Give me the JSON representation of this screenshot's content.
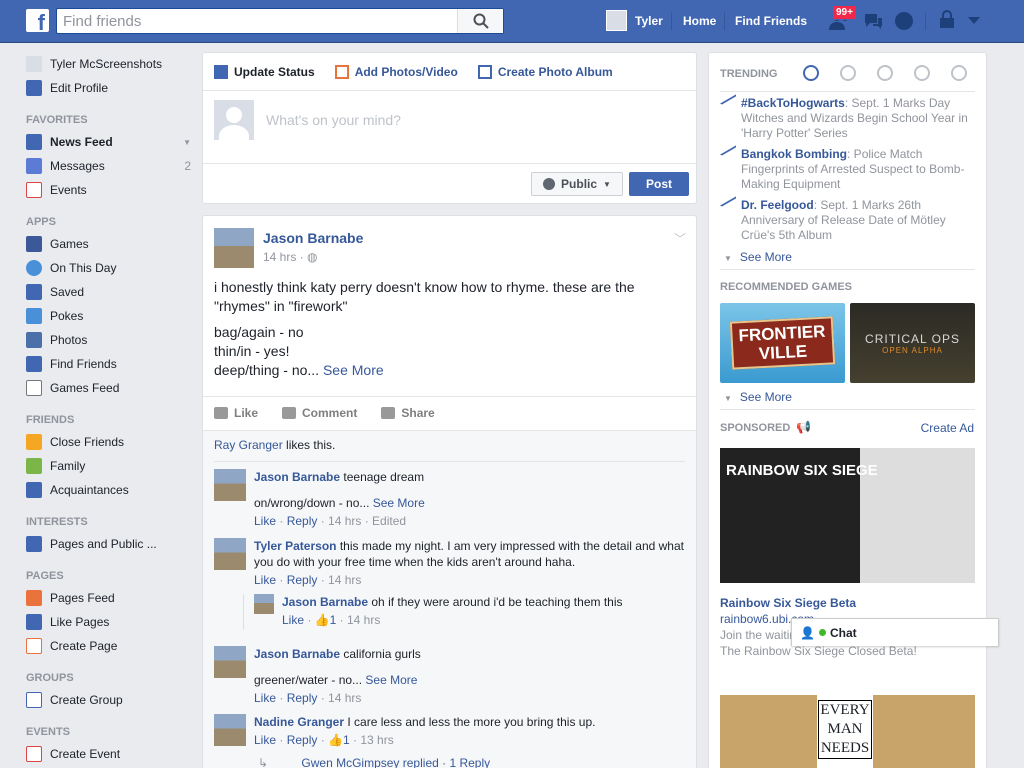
{
  "topbar": {
    "search_placeholder": "Find friends",
    "user_name": "Tyler",
    "home": "Home",
    "find_friends": "Find Friends",
    "friend_requests_badge": "99+"
  },
  "left_nav": {
    "user_name": "Tyler McScreenshots",
    "edit_profile": "Edit Profile",
    "favorites_header": "FAVORITES",
    "favorites": [
      {
        "label": "News Feed",
        "count": ""
      },
      {
        "label": "Messages",
        "count": "2"
      },
      {
        "label": "Events",
        "count": ""
      }
    ],
    "apps_header": "APPS",
    "apps": [
      "Games",
      "On This Day",
      "Saved",
      "Pokes",
      "Photos",
      "Find Friends",
      "Games Feed"
    ],
    "friends_header": "FRIENDS",
    "friends": [
      "Close Friends",
      "Family",
      "Acquaintances"
    ],
    "interests_header": "INTERESTS",
    "interests": [
      "Pages and Public ..."
    ],
    "pages_header": "PAGES",
    "pages": [
      "Pages Feed",
      "Like Pages",
      "Create Page"
    ],
    "groups_header": "GROUPS",
    "groups": [
      "Create Group"
    ],
    "events_header": "EVENTS",
    "events": [
      "Create Event"
    ]
  },
  "composer": {
    "tab_update_status": "Update Status",
    "tab_add_photos": "Add Photos/Video",
    "tab_create_album": "Create Photo Album",
    "placeholder": "What's on your mind?",
    "privacy": "Public",
    "post": "Post"
  },
  "post": {
    "author": "Jason Barnabe",
    "time": "14 hrs · ",
    "text_line1": "i honestly think katy perry doesn't know how to rhyme. these are the \"rhymes\" in \"firework\"",
    "text_line2": "bag/again - no",
    "text_line3": "thin/in - yes!",
    "text_line4": "deep/thing - no...",
    "see_more": "See More",
    "like": "Like",
    "comment": "Comment",
    "share": "Share",
    "likes_name": "Ray Granger",
    "likes_suffix": " likes this."
  },
  "comments": [
    {
      "name": "Jason Barnabe",
      "text": " teenage dream",
      "text2": "on/wrong/down - no...",
      "see_more": "See More",
      "like": "Like",
      "reply": "Reply",
      "time": " · 14 hrs · Edited"
    },
    {
      "name": "Tyler Paterson",
      "text": " this made my night. I am very impressed with the detail and what you do with your free time when the kids aren't around haha.",
      "like": "Like",
      "reply": "Reply",
      "time": " · 14 hrs"
    },
    {
      "name": "Jason Barnabe",
      "text": " oh if they were around i'd be teaching them this",
      "like": "Like",
      "likes": "1",
      "time": " · 14 hrs"
    },
    {
      "name": "Jason Barnabe",
      "text": " california gurls",
      "text2": "greener/water - no...",
      "see_more": "See More",
      "like": "Like",
      "reply": "Reply",
      "time": " · 14 hrs"
    },
    {
      "name": "Nadine Granger",
      "text": " I care less and less the more you bring this up.",
      "like": "Like",
      "reply": "Reply",
      "likes": "1",
      "time": " · 13 hrs"
    },
    {
      "name": "Gwen McGimpsey replied",
      "text": " · 1 Reply"
    }
  ],
  "right_rail": {
    "trending_title": "TRENDING",
    "trends": [
      {
        "topic": "#BackToHogwarts",
        "desc": ": Sept. 1 Marks Day Witches and Wizards Begin School Year in 'Harry Potter' Series"
      },
      {
        "topic": "Bangkok Bombing",
        "desc": ": Police Match Fingerprints of Arrested Suspect to Bomb-Making Equipment"
      },
      {
        "topic": "Dr. Feelgood",
        "desc": ": Sept. 1 Marks 26th Anniversary of Release Date of Mötley Crüe's 5th Album"
      }
    ],
    "see_more": "See More",
    "games_title": "RECOMMENDED GAMES",
    "game1_line1": "FRONTIER",
    "game1_line2": "VILLE",
    "game2_line1": "CRITICAL OPS",
    "game2_line2": "OPEN ALPHA",
    "sponsored_title": "SPONSORED",
    "create_ad": "Create Ad",
    "ad_banner": "RAINBOW SIX SIEGE",
    "ad_title": "Rainbow Six Siege Beta",
    "ad_domain": "rainbow6.ubi.com",
    "ad_text": "Join the waiting list and get a chance to Access The Rainbow Six Siege Closed Beta!",
    "ad2_line1": "EVERY",
    "ad2_line2": "MAN",
    "ad2_line3": "NEEDS"
  },
  "chat": {
    "label": "Chat"
  }
}
